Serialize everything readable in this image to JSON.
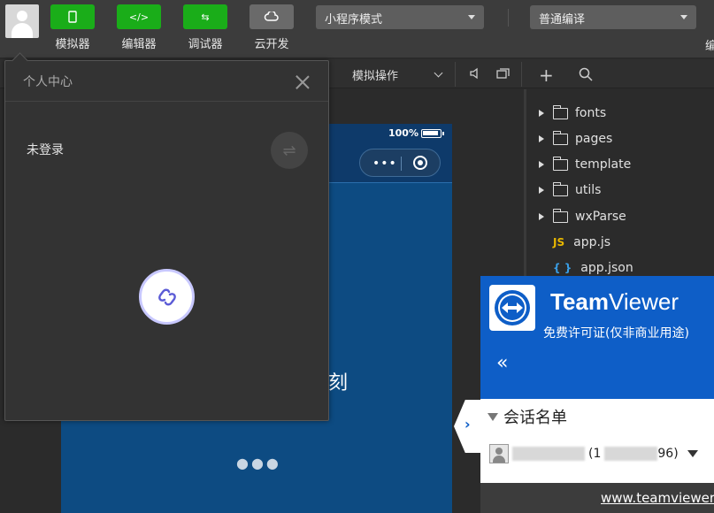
{
  "toolbar": {
    "tools": [
      {
        "label": "模拟器",
        "icon": "phone-icon"
      },
      {
        "label": "编辑器",
        "icon": "code-icon"
      },
      {
        "label": "调试器",
        "icon": "debug-icon"
      },
      {
        "label": "云开发",
        "icon": "cloud-icon"
      }
    ],
    "mode_select": "小程序模式",
    "compile_select": "普通编译",
    "edge_label": "编"
  },
  "subbar": {
    "simulate_op": "模拟操作"
  },
  "phone": {
    "battery_percent": "100%",
    "capsule_dots": "•••",
    "visible_text": "片刻",
    "loading_dots": "●●●"
  },
  "file_tree": [
    {
      "type": "folder",
      "name": "fonts"
    },
    {
      "type": "folder",
      "name": "pages"
    },
    {
      "type": "folder",
      "name": "template"
    },
    {
      "type": "folder",
      "name": "utils"
    },
    {
      "type": "folder",
      "name": "wxParse"
    },
    {
      "type": "file",
      "badge": "JS",
      "name": "app.js"
    },
    {
      "type": "file",
      "badge": "{ }",
      "name": "app.json"
    }
  ],
  "popup": {
    "title": "个人中心",
    "login_status": "未登录",
    "switch_icon": "⇌"
  },
  "teamviewer": {
    "brand_bold": "Team",
    "brand_rest": "Viewer",
    "license": "免费许可证(仅非商业用途)",
    "collapse": "«",
    "tab_arrow": "›",
    "session_title": "会话名单",
    "contact_prefix": "(1",
    "contact_suffix": "96)",
    "footer_link": "www.teamviewer"
  },
  "colors": {
    "toolbar_green": "#1aad19",
    "phone_blue": "#0d4b82",
    "teamviewer_blue": "#0e5ec7"
  }
}
